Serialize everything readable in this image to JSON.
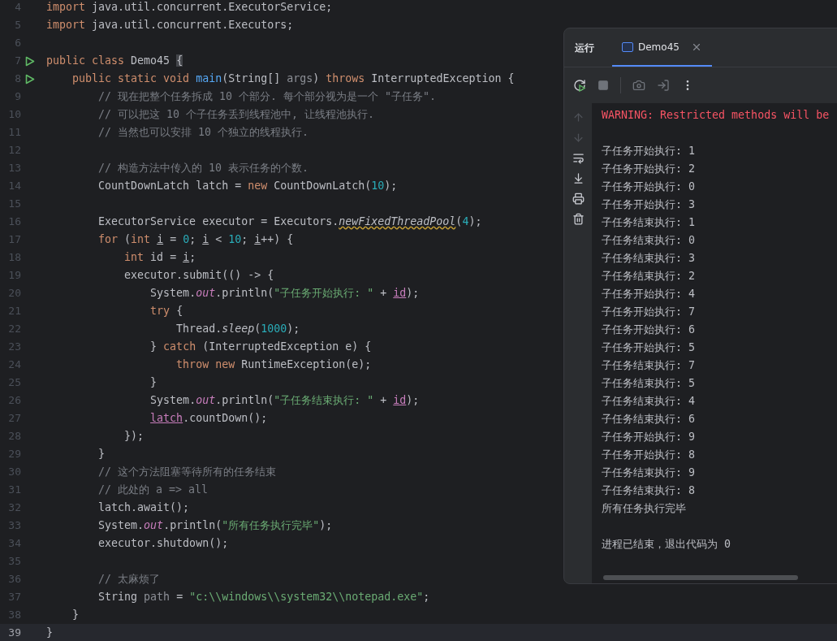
{
  "editor": {
    "lines": [
      {
        "number": "4",
        "run": false,
        "current": false,
        "tokens": [
          {
            "kind": "keyword",
            "text": "import "
          },
          {
            "kind": "plain",
            "text": "java.util.concurrent.ExecutorService;"
          }
        ]
      },
      {
        "number": "5",
        "run": false,
        "current": false,
        "tokens": [
          {
            "kind": "keyword",
            "text": "import "
          },
          {
            "kind": "plain",
            "text": "java.util.concurrent.Executors;"
          }
        ]
      },
      {
        "number": "6",
        "run": false,
        "current": false
      },
      {
        "number": "7",
        "run": true,
        "current": false,
        "tokens": [
          {
            "kind": "keyword",
            "text": "public class "
          },
          {
            "kind": "plain",
            "text": "Demo45 "
          },
          {
            "kind": "brace",
            "text": "{"
          }
        ]
      },
      {
        "number": "8",
        "run": true,
        "current": false,
        "tokens": [
          {
            "kind": "keyword",
            "text": "    public static void "
          },
          {
            "kind": "method",
            "text": "main"
          },
          {
            "kind": "plain",
            "text": "(String[] "
          },
          {
            "kind": "param",
            "text": "args"
          },
          {
            "kind": "plain",
            "text": ") "
          },
          {
            "kind": "keyword",
            "text": "throws "
          },
          {
            "kind": "plain",
            "text": "InterruptedException {"
          }
        ]
      },
      {
        "number": "9",
        "run": false,
        "current": false,
        "tokens": [
          {
            "kind": "comment",
            "text": "        // 现在把整个任务拆成 10 个部分. 每个部分视为是一个 \"子任务\"."
          }
        ]
      },
      {
        "number": "10",
        "run": false,
        "current": false,
        "tokens": [
          {
            "kind": "comment",
            "text": "        // 可以把这 10 个子任务丢到线程池中, 让线程池执行."
          }
        ]
      },
      {
        "number": "11",
        "run": false,
        "current": false,
        "tokens": [
          {
            "kind": "comment",
            "text": "        // 当然也可以安排 10 个独立的线程执行."
          }
        ]
      },
      {
        "number": "12",
        "run": false,
        "current": false
      },
      {
        "number": "13",
        "run": false,
        "current": false,
        "tokens": [
          {
            "kind": "comment",
            "text": "        // 构造方法中传入的 10 表示任务的个数."
          }
        ]
      },
      {
        "number": "14",
        "run": false,
        "current": false,
        "tokens": [
          {
            "kind": "plain",
            "text": "        CountDownLatch latch = "
          },
          {
            "kind": "keyword",
            "text": "new "
          },
          {
            "kind": "plain",
            "text": "CountDownLatch("
          },
          {
            "kind": "number",
            "text": "10"
          },
          {
            "kind": "plain",
            "text": ");"
          }
        ]
      },
      {
        "number": "15",
        "run": false,
        "current": false
      },
      {
        "number": "16",
        "run": false,
        "current": false,
        "tokens": [
          {
            "kind": "plain",
            "text": "        ExecutorService executor = Executors."
          },
          {
            "kind": "warned",
            "text": "newFixedThreadPool"
          },
          {
            "kind": "plain",
            "text": "("
          },
          {
            "kind": "number",
            "text": "4"
          },
          {
            "kind": "plain",
            "text": ");"
          }
        ]
      },
      {
        "number": "17",
        "run": false,
        "current": false,
        "tokens": [
          {
            "kind": "keyword",
            "text": "        for "
          },
          {
            "kind": "plain",
            "text": "("
          },
          {
            "kind": "keyword",
            "text": "int "
          },
          {
            "kind": "reassigned",
            "text": "i"
          },
          {
            "kind": "plain",
            "text": " = "
          },
          {
            "kind": "number",
            "text": "0"
          },
          {
            "kind": "plain",
            "text": "; "
          },
          {
            "kind": "reassigned",
            "text": "i"
          },
          {
            "kind": "plain",
            "text": " < "
          },
          {
            "kind": "number",
            "text": "10"
          },
          {
            "kind": "plain",
            "text": "; "
          },
          {
            "kind": "reassigned",
            "text": "i"
          },
          {
            "kind": "plain",
            "text": "++) {"
          }
        ]
      },
      {
        "number": "18",
        "run": false,
        "current": false,
        "tokens": [
          {
            "kind": "keyword",
            "text": "            int "
          },
          {
            "kind": "plain",
            "text": "id = "
          },
          {
            "kind": "reassigned",
            "text": "i"
          },
          {
            "kind": "plain",
            "text": ";"
          }
        ]
      },
      {
        "number": "19",
        "run": false,
        "current": false,
        "tokens": [
          {
            "kind": "plain",
            "text": "            executor.submit(() -> {"
          }
        ]
      },
      {
        "number": "20",
        "run": false,
        "current": false,
        "tokens": [
          {
            "kind": "plain",
            "text": "                System."
          },
          {
            "kind": "field",
            "text": "out"
          },
          {
            "kind": "plain",
            "text": ".println("
          },
          {
            "kind": "string",
            "text": "\"子任务开始执行: \""
          },
          {
            "kind": "plain",
            "text": " + "
          },
          {
            "kind": "captured",
            "text": "id"
          },
          {
            "kind": "plain",
            "text": ");"
          }
        ]
      },
      {
        "number": "21",
        "run": false,
        "current": false,
        "tokens": [
          {
            "kind": "keyword",
            "text": "                try "
          },
          {
            "kind": "plain",
            "text": "{"
          }
        ]
      },
      {
        "number": "22",
        "run": false,
        "current": false,
        "tokens": [
          {
            "kind": "plain",
            "text": "                    Thread."
          },
          {
            "kind": "static",
            "text": "sleep"
          },
          {
            "kind": "plain",
            "text": "("
          },
          {
            "kind": "number",
            "text": "1000"
          },
          {
            "kind": "plain",
            "text": ");"
          }
        ]
      },
      {
        "number": "23",
        "run": false,
        "current": false,
        "tokens": [
          {
            "kind": "plain",
            "text": "                } "
          },
          {
            "kind": "keyword",
            "text": "catch "
          },
          {
            "kind": "plain",
            "text": "(InterruptedException e) {"
          }
        ]
      },
      {
        "number": "24",
        "run": false,
        "current": false,
        "tokens": [
          {
            "kind": "keyword",
            "text": "                    throw new "
          },
          {
            "kind": "plain",
            "text": "RuntimeException(e);"
          }
        ]
      },
      {
        "number": "25",
        "run": false,
        "current": false,
        "tokens": [
          {
            "kind": "plain",
            "text": "                }"
          }
        ]
      },
      {
        "number": "26",
        "run": false,
        "current": false,
        "tokens": [
          {
            "kind": "plain",
            "text": "                System."
          },
          {
            "kind": "field",
            "text": "out"
          },
          {
            "kind": "plain",
            "text": ".println("
          },
          {
            "kind": "string",
            "text": "\"子任务结束执行: \""
          },
          {
            "kind": "plain",
            "text": " + "
          },
          {
            "kind": "captured",
            "text": "id"
          },
          {
            "kind": "plain",
            "text": ");"
          }
        ]
      },
      {
        "number": "27",
        "run": false,
        "current": false,
        "tokens": [
          {
            "kind": "captured",
            "text": "                latch"
          },
          {
            "kind": "plain",
            "text": ".countDown();"
          }
        ]
      },
      {
        "number": "28",
        "run": false,
        "current": false,
        "tokens": [
          {
            "kind": "plain",
            "text": "            });"
          }
        ]
      },
      {
        "number": "29",
        "run": false,
        "current": false,
        "tokens": [
          {
            "kind": "plain",
            "text": "        }"
          }
        ]
      },
      {
        "number": "30",
        "run": false,
        "current": false,
        "tokens": [
          {
            "kind": "comment",
            "text": "        // 这个方法阻塞等待所有的任务结束"
          }
        ]
      },
      {
        "number": "31",
        "run": false,
        "current": false,
        "tokens": [
          {
            "kind": "comment",
            "text": "        // 此处的 a => all"
          }
        ]
      },
      {
        "number": "32",
        "run": false,
        "current": false,
        "tokens": [
          {
            "kind": "plain",
            "text": "        latch.await();"
          }
        ]
      },
      {
        "number": "33",
        "run": false,
        "current": false,
        "tokens": [
          {
            "kind": "plain",
            "text": "        System."
          },
          {
            "kind": "field",
            "text": "out"
          },
          {
            "kind": "plain",
            "text": ".println("
          },
          {
            "kind": "string",
            "text": "\"所有任务执行完毕\""
          },
          {
            "kind": "plain",
            "text": ");"
          }
        ]
      },
      {
        "number": "34",
        "run": false,
        "current": false,
        "tokens": [
          {
            "kind": "plain",
            "text": "        executor.shutdown();"
          }
        ]
      },
      {
        "number": "35",
        "run": false,
        "current": false
      },
      {
        "number": "36",
        "run": false,
        "current": false,
        "tokens": [
          {
            "kind": "comment",
            "text": "        // 太麻烦了"
          }
        ]
      },
      {
        "number": "37",
        "run": false,
        "current": false,
        "tokens": [
          {
            "kind": "plain",
            "text": "        String "
          },
          {
            "kind": "param",
            "text": "path"
          },
          {
            "kind": "plain",
            "text": " = "
          },
          {
            "kind": "string",
            "text": "\"c:\\\\windows\\\\system32\\\\notepad.exe\""
          },
          {
            "kind": "plain",
            "text": ";"
          }
        ]
      },
      {
        "number": "38",
        "run": false,
        "current": false,
        "tokens": [
          {
            "kind": "plain",
            "text": "    }"
          }
        ]
      },
      {
        "number": "39",
        "run": false,
        "current": true,
        "tokens": [
          {
            "kind": "plain",
            "text": "}"
          }
        ]
      }
    ]
  },
  "run_panel": {
    "title": "运行",
    "tabs": [
      {
        "label": "Demo45",
        "selected": true
      }
    ],
    "console": [
      {
        "kind": "warning",
        "text": "WARNING: Restricted methods will be"
      },
      {
        "kind": "blank"
      },
      {
        "kind": "output",
        "text": "子任务开始执行: 1"
      },
      {
        "kind": "output",
        "text": "子任务开始执行: 2"
      },
      {
        "kind": "output",
        "text": "子任务开始执行: 0"
      },
      {
        "kind": "output",
        "text": "子任务开始执行: 3"
      },
      {
        "kind": "output",
        "text": "子任务结束执行: 1"
      },
      {
        "kind": "output",
        "text": "子任务结束执行: 0"
      },
      {
        "kind": "output",
        "text": "子任务结束执行: 3"
      },
      {
        "kind": "output",
        "text": "子任务结束执行: 2"
      },
      {
        "kind": "output",
        "text": "子任务开始执行: 4"
      },
      {
        "kind": "output",
        "text": "子任务开始执行: 7"
      },
      {
        "kind": "output",
        "text": "子任务开始执行: 6"
      },
      {
        "kind": "output",
        "text": "子任务开始执行: 5"
      },
      {
        "kind": "output",
        "text": "子任务结束执行: 7"
      },
      {
        "kind": "output",
        "text": "子任务结束执行: 5"
      },
      {
        "kind": "output",
        "text": "子任务结束执行: 4"
      },
      {
        "kind": "output",
        "text": "子任务结束执行: 6"
      },
      {
        "kind": "output",
        "text": "子任务开始执行: 9"
      },
      {
        "kind": "output",
        "text": "子任务开始执行: 8"
      },
      {
        "kind": "output",
        "text": "子任务结束执行: 9"
      },
      {
        "kind": "output",
        "text": "子任务结束执行: 8"
      },
      {
        "kind": "output",
        "text": "所有任务执行完毕"
      },
      {
        "kind": "blank"
      },
      {
        "kind": "output",
        "text": "进程已结束，退出代码为 0"
      }
    ]
  }
}
